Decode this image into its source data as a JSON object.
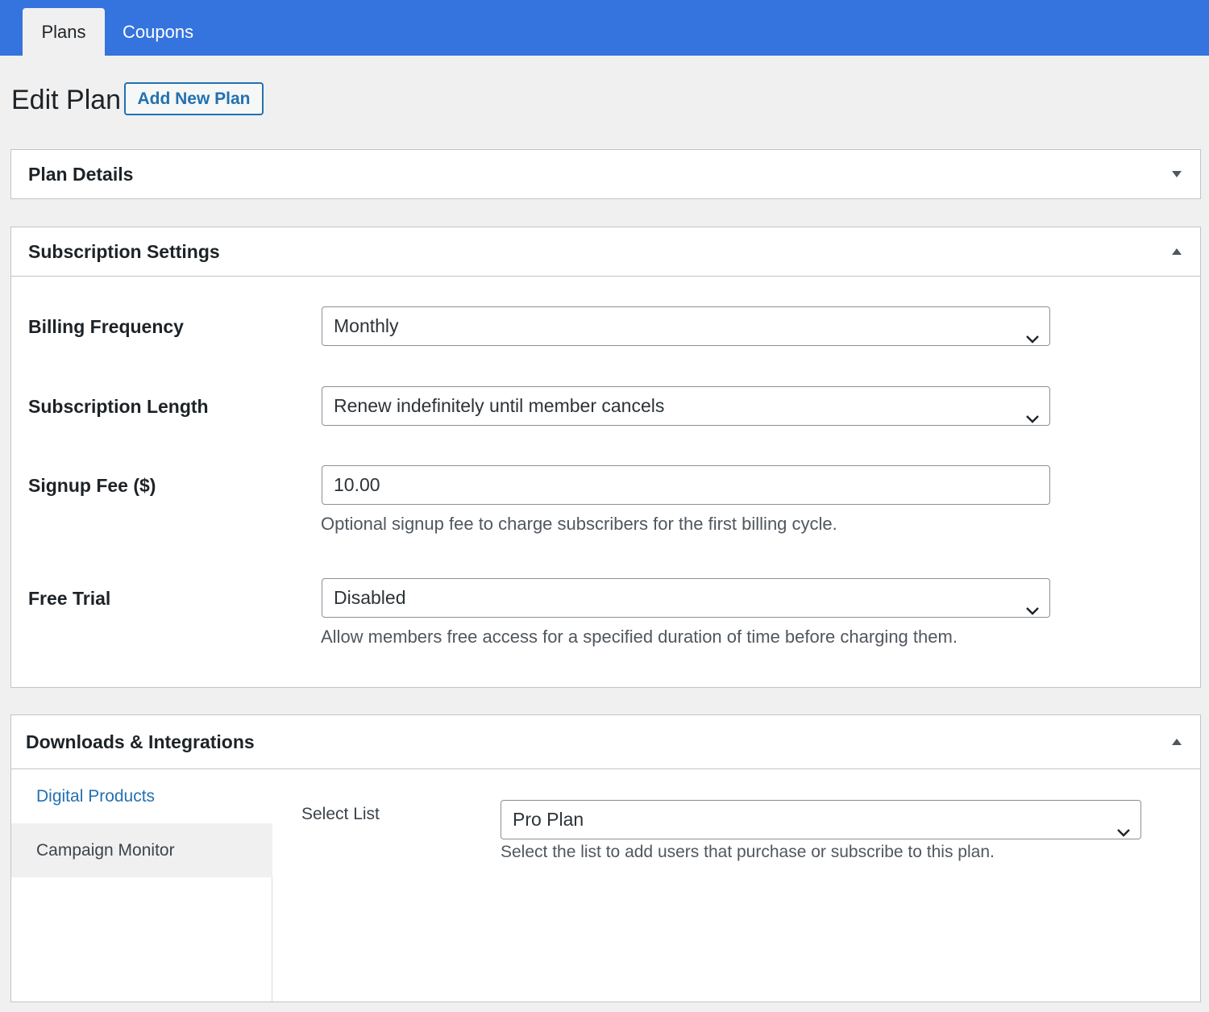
{
  "tabs": [
    {
      "label": "Plans",
      "active": true
    },
    {
      "label": "Coupons",
      "active": false
    }
  ],
  "header": {
    "title": "Edit Plan",
    "add_new_label": "Add New Plan"
  },
  "plan_details": {
    "title": "Plan Details",
    "state": "collapsed"
  },
  "subscription_settings": {
    "title": "Subscription Settings",
    "state": "expanded",
    "rows": [
      {
        "label": "Billing Frequency",
        "value": "Monthly",
        "type": "select",
        "description": ""
      },
      {
        "label": "Subscription Length",
        "value": "Renew indefinitely until member cancels",
        "type": "select",
        "description": ""
      },
      {
        "label": "Signup Fee ($)",
        "value": "10.00",
        "type": "text",
        "description": "Optional signup fee to charge subscribers for the first billing cycle."
      },
      {
        "label": "Free Trial",
        "value": "Disabled",
        "type": "select",
        "description": "Allow members free access for a specified duration of time before charging them."
      }
    ]
  },
  "downloads": {
    "title": "Downloads & Integrations",
    "state": "expanded",
    "nav": [
      {
        "label": "Digital Products"
      },
      {
        "label": "Campaign Monitor"
      }
    ],
    "select_list_label": "Select List",
    "select_list_value": "Pro Plan",
    "select_list_description": "Select the list to add users that purchase or subscribe to this plan."
  },
  "icons": {
    "collapse": "triangle-down-icon",
    "expand": "triangle-up-icon",
    "select": "chevron-down-icon"
  },
  "colors": {
    "topbar": "#3573de",
    "link": "#2271b1",
    "background": "#f0f0f1"
  }
}
